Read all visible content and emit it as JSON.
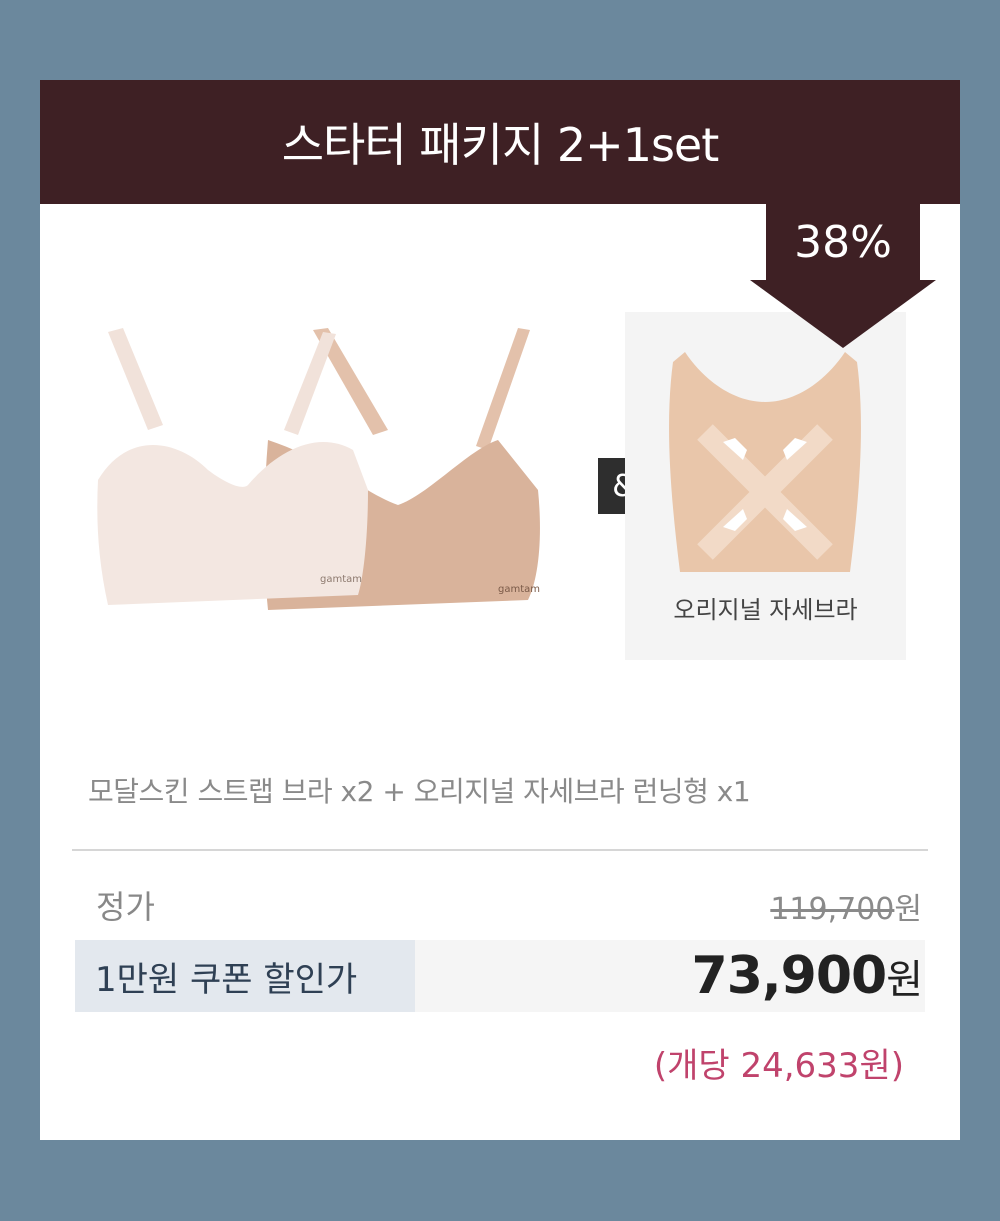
{
  "banner": {
    "title": "스타터 패키지 2+1set"
  },
  "discount_badge": {
    "text": "38%"
  },
  "connector": {
    "symbol": "&"
  },
  "product": {
    "brand_mark": "gamtam"
  },
  "side_product": {
    "caption": "오리지널 자세브라"
  },
  "description": "모달스킨 스트랩 브라 x2 + 오리지널 자세브라 런닝형 x1",
  "pricing": {
    "regular_label": "정가",
    "regular_price": "119,700",
    "currency": "원",
    "coupon_label": "1만원 쿠폰 할인가",
    "sale_price": "73,900",
    "unit_price_text": "(개당 24,633원)"
  },
  "colors": {
    "background": "#6b889d",
    "banner": "#3e2024",
    "accent_pink": "#c0436c",
    "coupon_bg": "#e3e8ee"
  }
}
